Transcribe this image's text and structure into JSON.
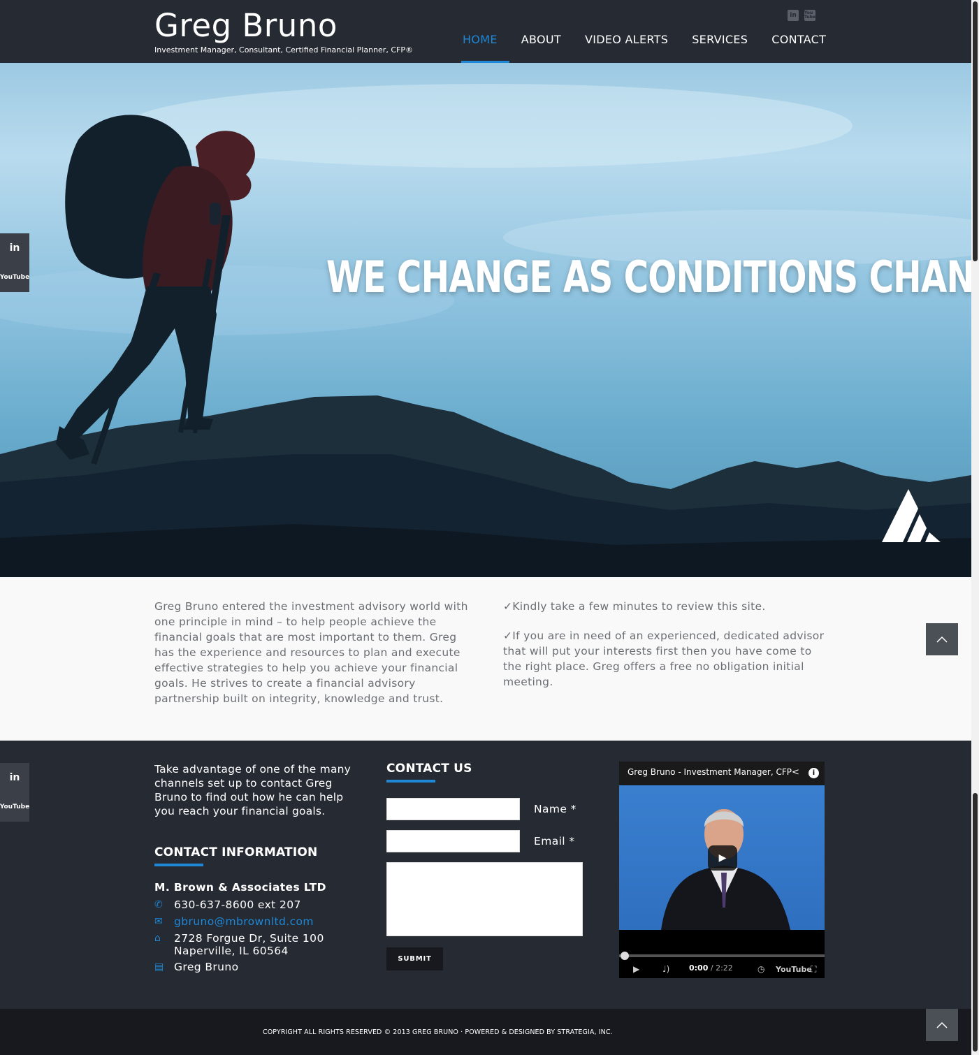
{
  "header": {
    "site_title": "Greg Bruno",
    "tagline": "Investment Manager, Consultant, Certified Financial Planner, CFP®",
    "nav": [
      {
        "label": "HOME",
        "active": true
      },
      {
        "label": "ABOUT"
      },
      {
        "label": "VIDEO ALERTS"
      },
      {
        "label": "SERVICES"
      },
      {
        "label": "CONTACT"
      }
    ],
    "top_social": {
      "linkedin": "in",
      "youtube": "You Tube"
    }
  },
  "hero": {
    "headline": "WE CHANGE AS CONDITIONS CHANGE"
  },
  "side_social": {
    "linkedin": "in",
    "youtube_line1": "You",
    "youtube_line2": "Tube"
  },
  "intro": {
    "left_text": "Greg Bruno entered the investment advisory world with one principle in mind – to help people achieve the financial goals that are most important to them. Greg has the experience and resources to plan and execute effective strategies to help you achieve your financial goals. He strives to create a financial advisory partnership built on integrity, knowledge and trust.",
    "right_p1": "✓Kindly take a few minutes to review this site.",
    "right_p2": "✓If you are in need of an experienced, dedicated advisor that will put your interests first then you have come to the right place. Greg offers a free no obligation initial meeting."
  },
  "contact_info": {
    "lead": "Take advantage of one of the many channels set up to contact Greg Bruno to find out how he can help you reach your financial goals.",
    "heading": "CONTACT INFORMATION",
    "company": "M. Brown & Associates LTD",
    "phone": "630-637-8600 ext 207",
    "email": "gbruno@mbrownltd.com",
    "address_line1": "2728 Forgue Dr, Suite 100",
    "address_line2": "Naperville, IL 60564",
    "name": "Greg Bruno"
  },
  "contact_form": {
    "heading": "CONTACT US",
    "name_label": "Name *",
    "email_label": "Email *",
    "submit_label": "SUBMIT"
  },
  "video": {
    "title": "Greg Bruno - Investment Manager, CFP",
    "time_current": "0:00",
    "time_total": "/ 2:22",
    "brand": "YouTube"
  },
  "footer": {
    "copyright": "COPYRIGHT ALL RIGHTS RESERVED © 2013 GREG BRUNO · POWERED & DESIGNED BY STRATEGIA, INC."
  },
  "colors": {
    "accent": "#1e88d6",
    "dark": "#262a33",
    "intro_bg": "#f9f9f9"
  }
}
